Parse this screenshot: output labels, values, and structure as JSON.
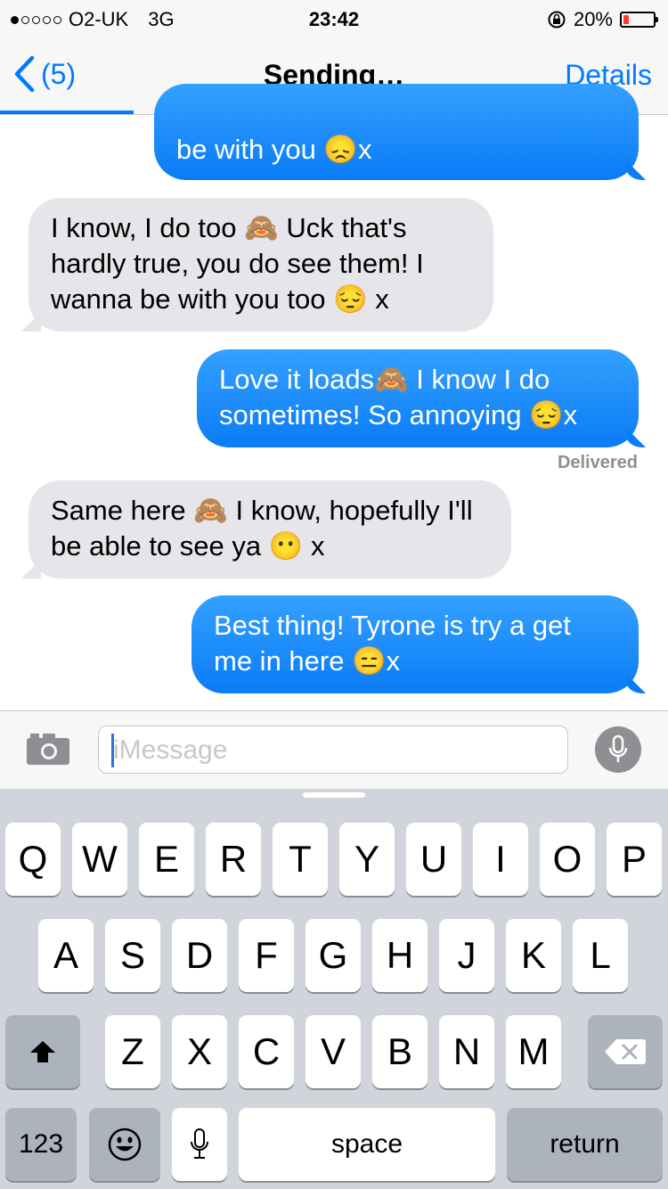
{
  "status_bar": {
    "carrier": "O2-UK",
    "network": "3G",
    "time": "23:42",
    "battery_text": "20%",
    "battery_level": 0.2,
    "signal_dots_filled": 1,
    "signal_dots_total": 5
  },
  "nav": {
    "back_count": "(5)",
    "title": "Sending…",
    "details": "Details",
    "send_progress": 0.2
  },
  "messages": [
    {
      "side": "sent",
      "text": "be with you 😞x"
    },
    {
      "side": "received",
      "text": "I know, I do too 🙈 Uck that's hardly true, you do see them! I wanna be with you too 😔 x"
    },
    {
      "side": "sent",
      "text": "Love it loads🙈 I know I do sometimes! So annoying 😔x"
    },
    {
      "side": "received",
      "text": "Same here 🙈 I know, hopefully I'll be able to see ya 😶 x"
    },
    {
      "side": "sent",
      "text": "Best thing! Tyrone is try a get me in here 😑x"
    }
  ],
  "delivered_label": "Delivered",
  "input": {
    "placeholder": "iMessage"
  },
  "keyboard": {
    "row1": [
      "Q",
      "W",
      "E",
      "R",
      "T",
      "Y",
      "U",
      "I",
      "O",
      "P"
    ],
    "row2": [
      "A",
      "S",
      "D",
      "F",
      "G",
      "H",
      "J",
      "K",
      "L"
    ],
    "row3": [
      "Z",
      "X",
      "C",
      "V",
      "B",
      "N",
      "M"
    ],
    "numbers": "123",
    "space": "space",
    "return": "return"
  },
  "colors": {
    "accent": "#007aff",
    "sent_bubble": "#1a8cff",
    "received_bubble": "#e5e5ea",
    "battery_low": "#ff3b30"
  },
  "icons": [
    "chevron-left-icon",
    "camera-icon",
    "microphone-icon",
    "shift-icon",
    "backspace-icon",
    "emoji-icon",
    "dictation-icon",
    "lock-rotation-icon"
  ]
}
